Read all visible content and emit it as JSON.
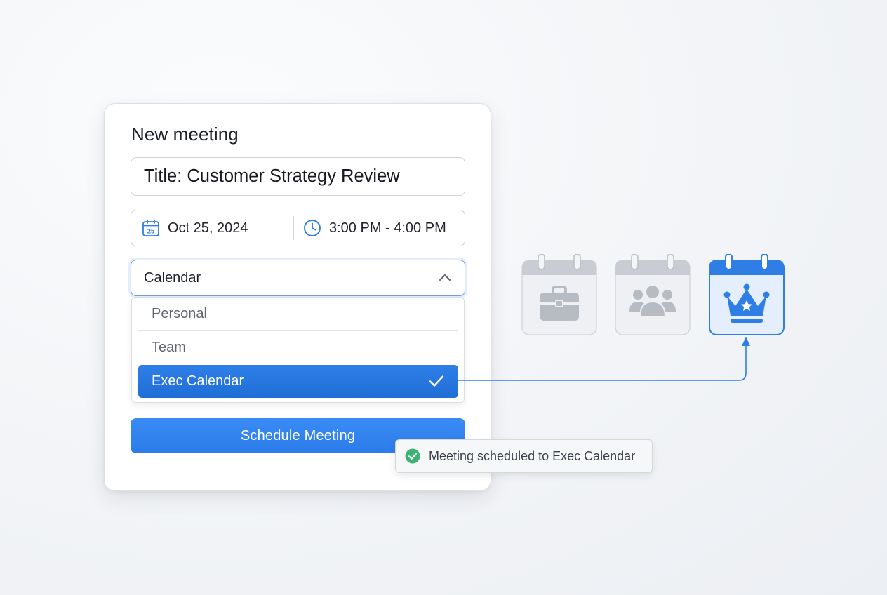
{
  "dialog": {
    "heading": "New meeting",
    "title_value": "Title: Customer Strategy Review",
    "date_icon_day": "25",
    "date": "Oct 25, 2024",
    "time": "3:00 PM - 4:00 PM",
    "calendar_select_label": "Calendar",
    "calendar_options": [
      {
        "label": "Personal",
        "selected": false
      },
      {
        "label": "Team",
        "selected": false
      },
      {
        "label": "Exec Calendar",
        "selected": true
      }
    ],
    "schedule_button": "Schedule Meeting"
  },
  "toast": {
    "message": "Meeting scheduled to Exec Calendar",
    "status": "success",
    "icon": "check-circle-icon",
    "color": "#3cb371"
  },
  "calendar_types": [
    {
      "icon": "briefcase-calendar-icon",
      "active": false
    },
    {
      "icon": "people-calendar-icon",
      "active": false
    },
    {
      "icon": "crown-calendar-icon",
      "active": true
    }
  ],
  "colors": {
    "accent": "#2b7ce9",
    "selected_option": "#1f6ed6",
    "inactive_icon": "#b7bcc3",
    "success": "#3cb371"
  }
}
